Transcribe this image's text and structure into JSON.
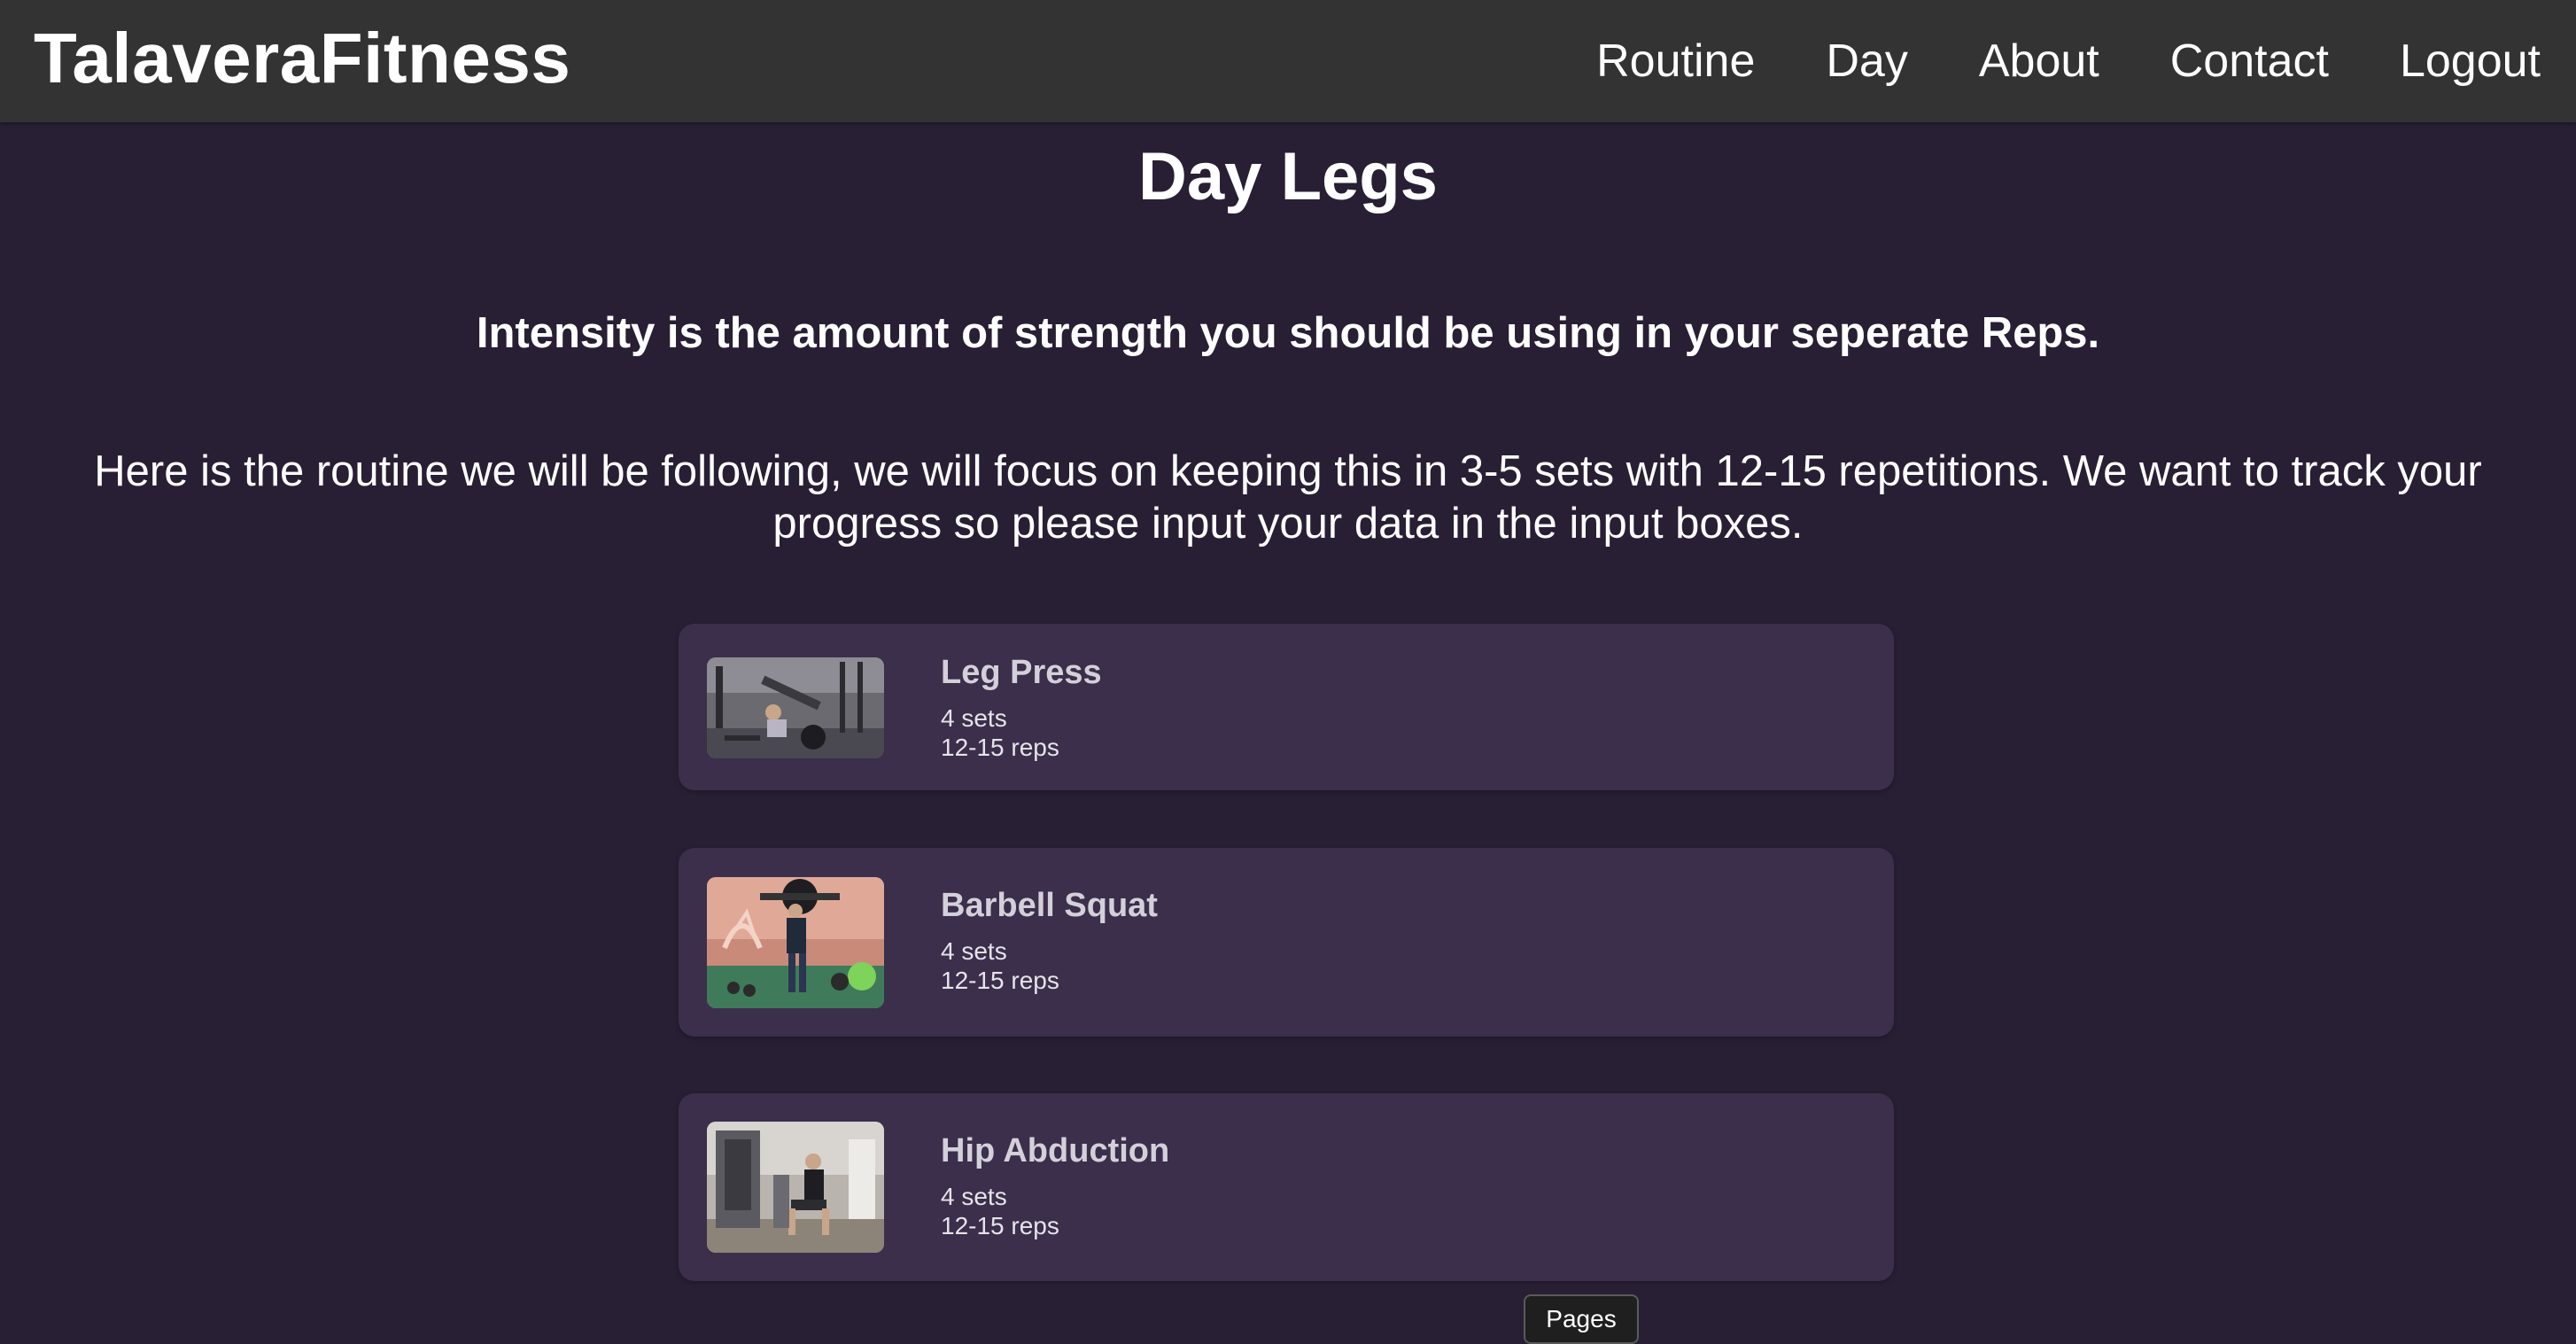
{
  "header": {
    "brand": "TalaveraFitness",
    "nav": [
      {
        "label": "Routine"
      },
      {
        "label": "Day"
      },
      {
        "label": "About"
      },
      {
        "label": "Contact"
      },
      {
        "label": "Logout"
      }
    ]
  },
  "main": {
    "title": "Day Legs",
    "intensity_note": "Intensity is the amount of strength you should be using in your seperate Reps.",
    "routine_description": "Here is the routine we will be following, we will focus on keeping this in 3-5 sets with 12-15 repetitions. We want to track your progress so please input your data in the input boxes.",
    "exercises": [
      {
        "name": "Leg Press",
        "sets": "4 sets",
        "reps": "12-15 reps"
      },
      {
        "name": "Barbell Squat",
        "sets": "4 sets",
        "reps": "12-15 reps"
      },
      {
        "name": "Hip Abduction",
        "sets": "4 sets",
        "reps": "12-15 reps"
      }
    ]
  },
  "footer": {
    "pages_label": "Pages"
  }
}
